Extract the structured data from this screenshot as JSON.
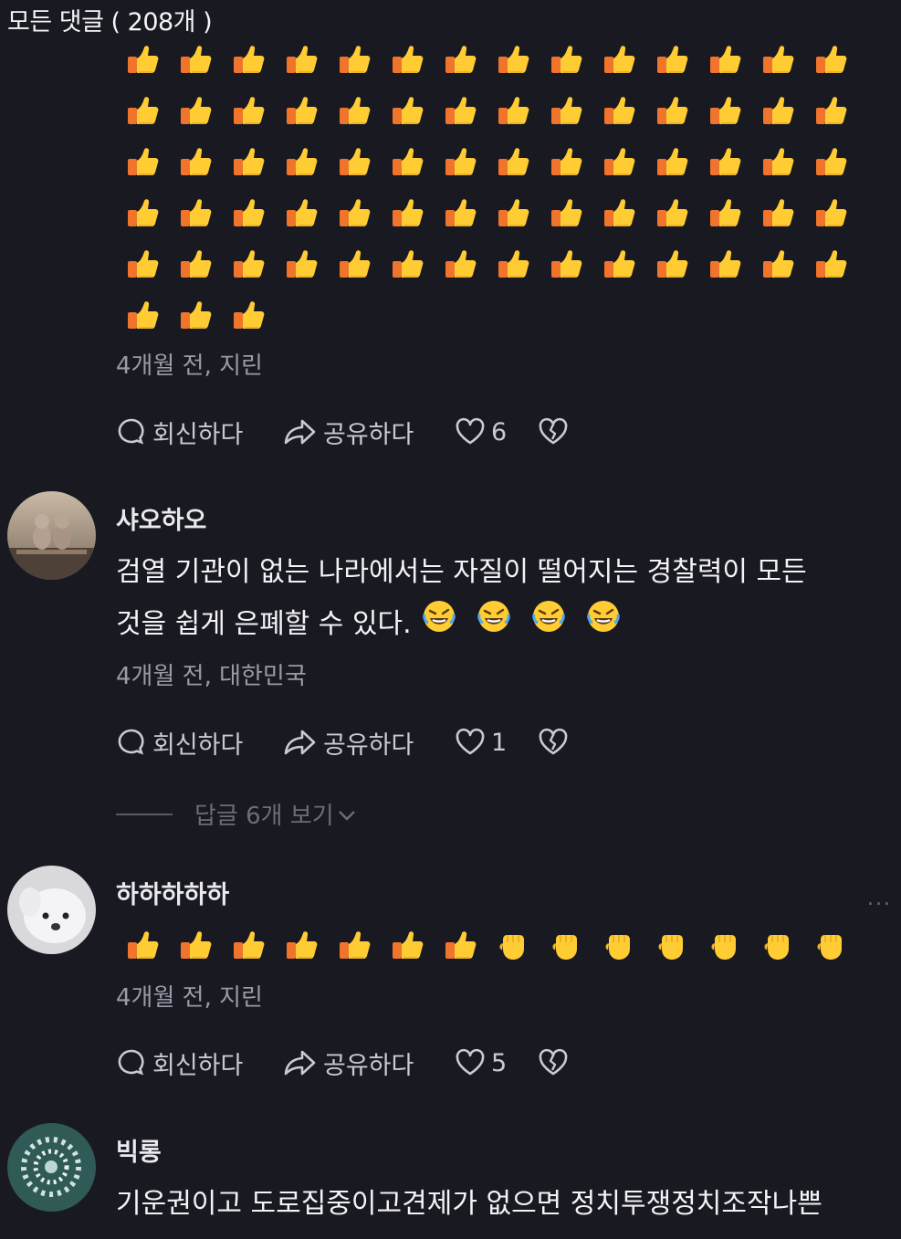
{
  "header": {
    "title": "모든 댓글 ( 208개 )"
  },
  "colors": {
    "background": "#181921",
    "text": "#f2f2f4",
    "meta": "#9a9ba6",
    "thumb_yellow": "#ffcc33",
    "thumb_sleeve": "#f0742c"
  },
  "actions_labels": {
    "reply": "회신하다",
    "share": "공유하다"
  },
  "comments": [
    {
      "username": "",
      "emoji_icon": "thumbs-up",
      "emoji_count": 73,
      "meta": "4개월 전, 지린",
      "likes": "6"
    },
    {
      "username": "샤오하오",
      "text_line1": "검열 기관이 없는 나라에서는 자질이 떨어지는 경찰력이 모든",
      "text_line2": "것을 쉽게 은폐할 수 있다.",
      "trailing_emoji_icon": "rolling-laughing",
      "trailing_emoji_count": 4,
      "meta": "4개월 전, 대한민국",
      "likes": "1",
      "replies_label": "답글 6개 보기"
    },
    {
      "username": "하하하하하",
      "emoji_sequence": [
        "thumbs-up",
        "thumbs-up",
        "thumbs-up",
        "thumbs-up",
        "thumbs-up",
        "thumbs-up",
        "thumbs-up",
        "raised-fist",
        "raised-fist",
        "raised-fist",
        "raised-fist",
        "raised-fist",
        "raised-fist",
        "raised-fist"
      ],
      "meta": "4개월 전, 지린",
      "likes": "5",
      "more": "..."
    },
    {
      "username": "빅롱",
      "text_line1": "기운권이고 도로집중이고견제가 없으면 정치투쟁정치조작나쁜"
    }
  ]
}
